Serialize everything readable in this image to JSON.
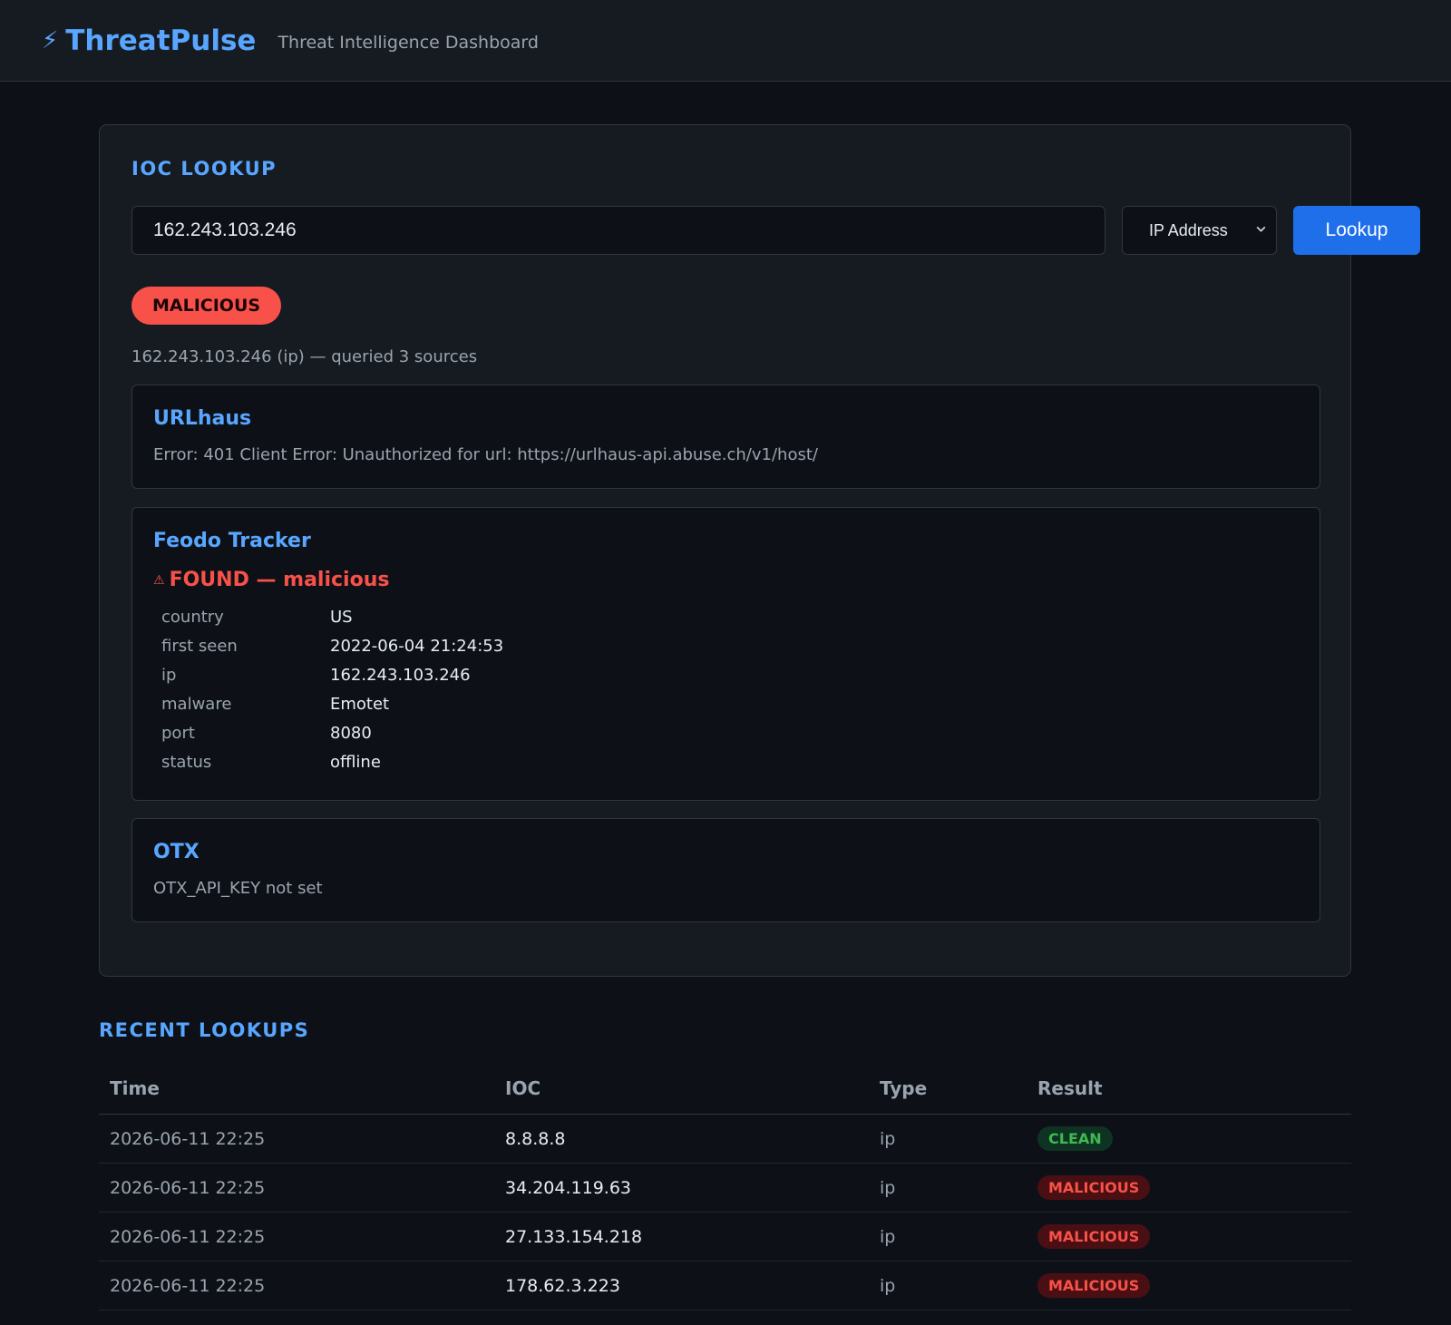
{
  "header": {
    "logo_icon": "⚡",
    "brand": "ThreatPulse",
    "subtitle": "Threat Intelligence Dashboard"
  },
  "lookup": {
    "title": "IOC LOOKUP",
    "input_value": "162.243.103.246",
    "type_selected": "IP Address",
    "button_label": "Lookup",
    "verdict": "MALICIOUS",
    "summary": "162.243.103.246 (ip) — queried 3 sources"
  },
  "sources": {
    "urlhaus": {
      "name": "URLhaus",
      "message": "Error: 401 Client Error: Unauthorized for url: https://urlhaus-api.abuse.ch/v1/host/"
    },
    "feodo": {
      "name": "Feodo Tracker",
      "status_icon": "⚠",
      "status": "FOUND — malicious",
      "details": [
        {
          "key": "country",
          "value": "US"
        },
        {
          "key": "first seen",
          "value": "2022-06-04 21:24:53"
        },
        {
          "key": "ip",
          "value": "162.243.103.246"
        },
        {
          "key": "malware",
          "value": "Emotet"
        },
        {
          "key": "port",
          "value": "8080"
        },
        {
          "key": "status",
          "value": "offline"
        }
      ]
    },
    "otx": {
      "name": "OTX",
      "message": "OTX_API_KEY not set"
    }
  },
  "recent": {
    "title": "RECENT LOOKUPS",
    "columns": [
      "Time",
      "IOC",
      "Type",
      "Result"
    ],
    "rows": [
      {
        "time": "2026-06-11 22:25",
        "ioc": "8.8.8.8",
        "type": "ip",
        "result": "CLEAN"
      },
      {
        "time": "2026-06-11 22:25",
        "ioc": "34.204.119.63",
        "type": "ip",
        "result": "MALICIOUS"
      },
      {
        "time": "2026-06-11 22:25",
        "ioc": "27.133.154.218",
        "type": "ip",
        "result": "MALICIOUS"
      },
      {
        "time": "2026-06-11 22:25",
        "ioc": "178.62.3.223",
        "type": "ip",
        "result": "MALICIOUS"
      }
    ]
  },
  "colors": {
    "accent": "#58a6ff",
    "button": "#1f6feb",
    "malicious": "#f85149",
    "clean": "#3fb950",
    "background": "#0d1117",
    "panel": "#161b22"
  }
}
